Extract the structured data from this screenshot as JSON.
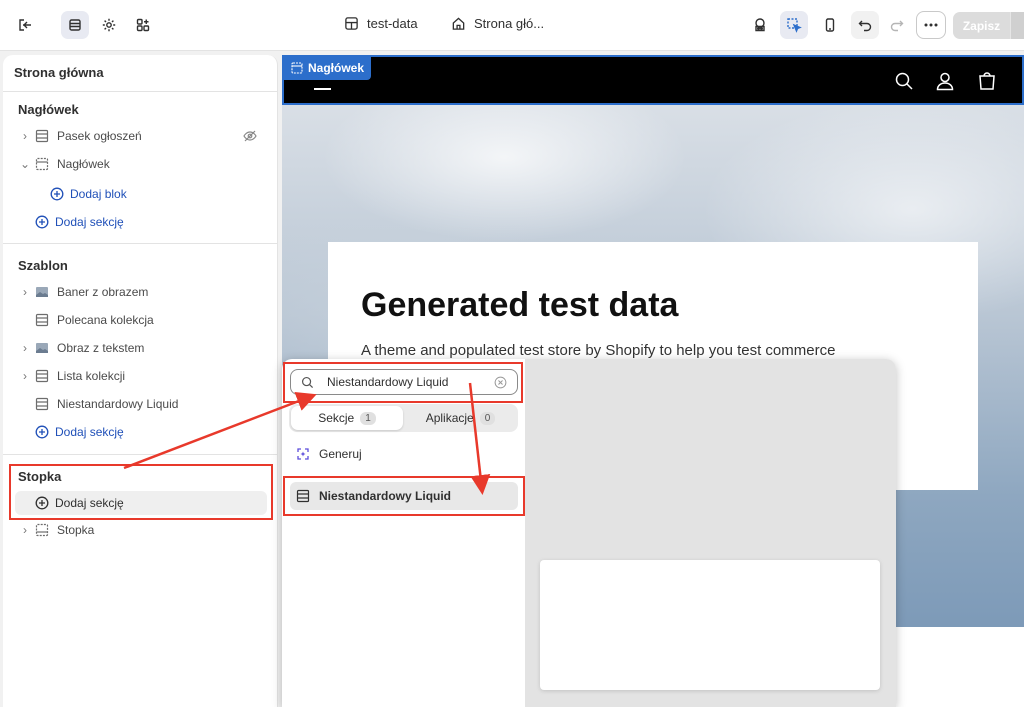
{
  "colors": {
    "accent": "#2c6ecb",
    "link": "#2050b8",
    "annotation": "#e8392b",
    "header_bg": "#000000"
  },
  "topbar": {
    "doc_title": "test-data",
    "page_title": "Strona głó...",
    "save_label": "Zapisz",
    "icons": [
      "exit-icon",
      "sections-icon",
      "gear-icon",
      "apps-icon",
      "inspector-icon",
      "select-icon",
      "mobile-icon",
      "undo-icon",
      "redo-icon",
      "more-icon"
    ]
  },
  "sidebar": {
    "title": "Strona główna",
    "header_group": {
      "heading": "Nagłówek",
      "items": [
        {
          "label": "Pasek ogłoszeń",
          "icon": "section-icon",
          "hidden": true
        },
        {
          "label": "Nagłówek",
          "icon": "header-icon"
        }
      ],
      "add_block": "Dodaj blok",
      "add_section": "Dodaj sekcję"
    },
    "template_group": {
      "heading": "Szablon",
      "items": [
        {
          "label": "Baner z obrazem",
          "icon": "image-icon"
        },
        {
          "label": "Polecana kolekcja",
          "icon": "section-icon"
        },
        {
          "label": "Obraz z tekstem",
          "icon": "image-icon"
        },
        {
          "label": "Lista kolekcji",
          "icon": "section-icon"
        },
        {
          "label": "Niestandardowy Liquid",
          "icon": "section-icon"
        }
      ],
      "add_section": "Dodaj sekcję"
    },
    "footer_group": {
      "heading": "Stopka",
      "add_section": "Dodaj sekcję",
      "items": [
        {
          "label": "Stopka",
          "icon": "footer-icon"
        }
      ]
    }
  },
  "preview": {
    "header_tag": "Nagłówek",
    "hero_title": "Generated test data",
    "hero_subtitle": "A theme and populated test store by Shopify to help you test commerce"
  },
  "popup": {
    "search_value": "Niestandardowy Liquid",
    "tabs": [
      {
        "label": "Sekcje",
        "count": "1",
        "selected": true
      },
      {
        "label": "Aplikacje",
        "count": "0",
        "selected": false
      }
    ],
    "generate_label": "Generuj",
    "result_label": "Niestandardowy Liquid"
  }
}
